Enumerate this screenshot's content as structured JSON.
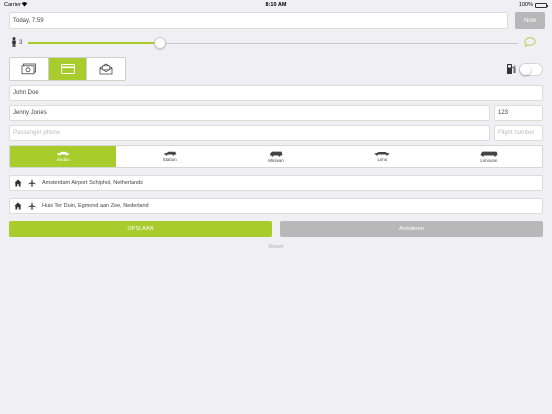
{
  "status_bar": {
    "carrier": "Carrier",
    "time": "8:10 AM",
    "battery": "100%"
  },
  "pickup_time": {
    "value": "Today, 7:59",
    "now_label": "Now"
  },
  "passengers": {
    "count": "3",
    "level": 0.27
  },
  "payment": {
    "options": [
      "cash-icon",
      "card-icon",
      "invoice-icon"
    ],
    "selected": "card-icon"
  },
  "fuel_toggle": {
    "on": false
  },
  "booker": {
    "name": "John Doe"
  },
  "passenger": {
    "name": "Jenny Jones",
    "flight": "123",
    "phone_placeholder": "Passenger phone",
    "flight_placeholder": "Flight number"
  },
  "vehicles": [
    {
      "label": "Sedan",
      "active": true
    },
    {
      "label": "Station",
      "active": false
    },
    {
      "label": "Minivan",
      "active": false
    },
    {
      "label": "Limo",
      "active": false
    },
    {
      "label": "Limovan",
      "active": false
    }
  ],
  "addresses": {
    "from": "Amsterdam Airport Schiphol, Netherlands",
    "to": "Huis Ter Duin, Egmond aan Zee, Nederland"
  },
  "actions": {
    "save": "OPSLAAN",
    "cancel": "Annuleren",
    "reset": "Reset"
  },
  "colors": {
    "accent": "#a8cc2b",
    "inactive": "#b8b8b8",
    "background": "#efeff4"
  }
}
